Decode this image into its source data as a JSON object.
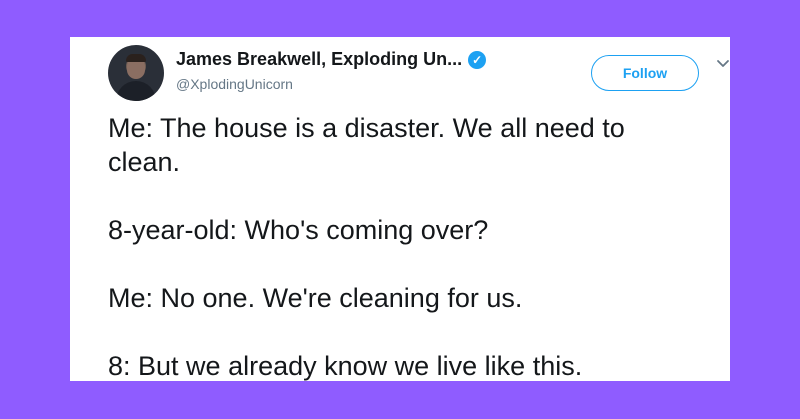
{
  "tweet": {
    "display_name": "James Breakwell, Exploding Un...",
    "handle": "@XplodingUnicorn",
    "verified_icon": "verified-check-icon",
    "follow_label": "Follow",
    "lines": [
      "Me: The house is a disaster. We all need to",
      "clean.",
      "8-year-old: Who's coming over?",
      "Me: No one. We're cleaning for us.",
      "8: But we already know we live like this."
    ]
  },
  "colors": {
    "background": "#8f5cff",
    "card": "#ffffff",
    "accent": "#1da1f2",
    "text": "#14171a",
    "muted": "#657786"
  }
}
